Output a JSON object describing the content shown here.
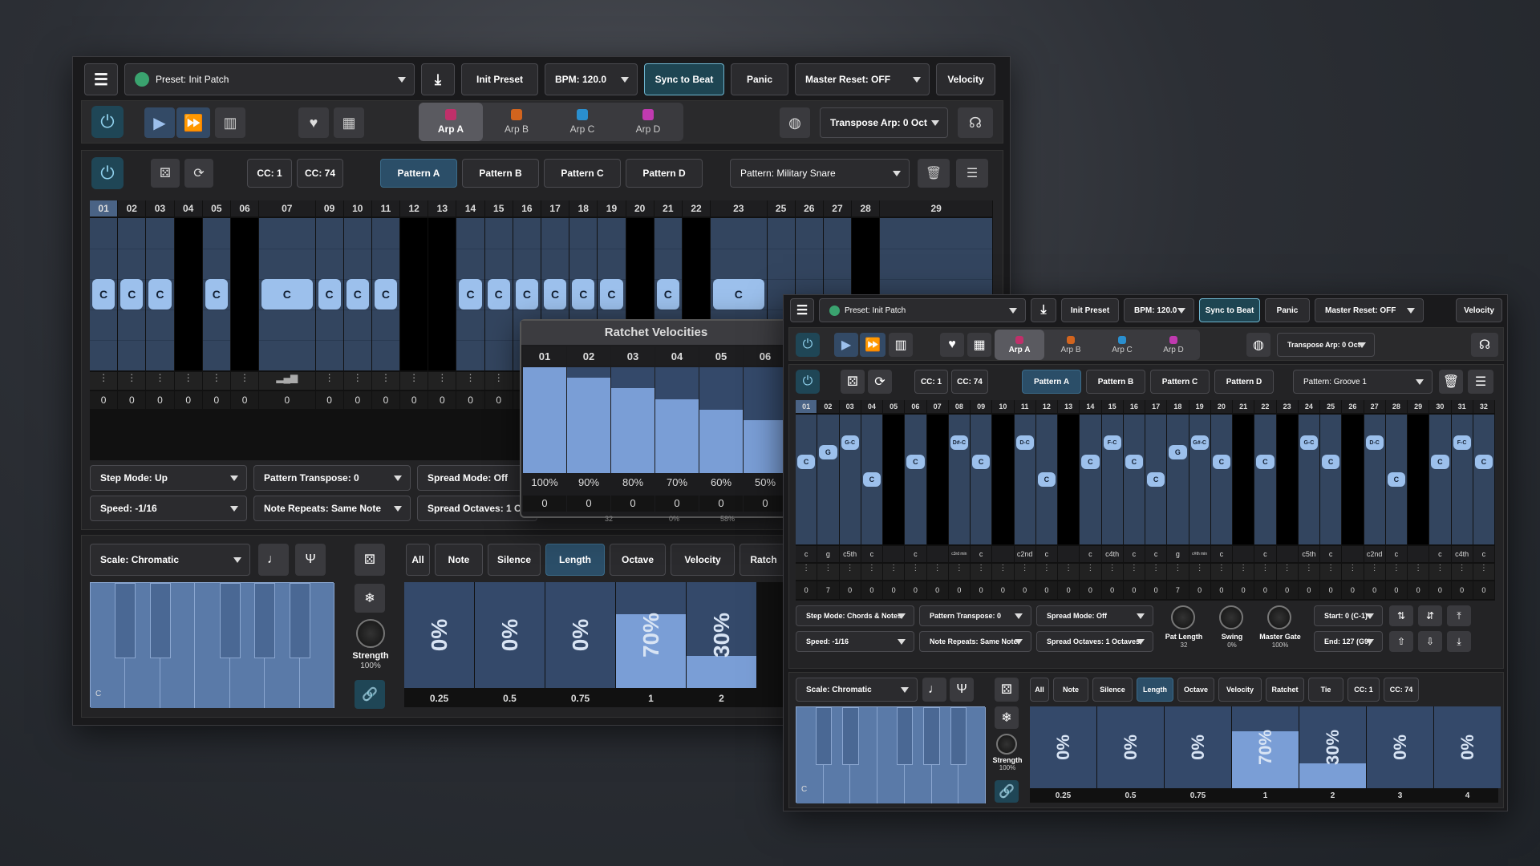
{
  "left": {
    "preset": "Preset: Init Patch",
    "init_preset": "Init Preset",
    "bpm": "BPM: 120.0",
    "sync": "Sync to Beat",
    "panic": "Panic",
    "master_reset": "Master Reset: OFF",
    "velocity": "Velocity",
    "arps": [
      "Arp A",
      "Arp B",
      "Arp C",
      "Arp D"
    ],
    "transpose_arp": "Transpose Arp: 0 Oct",
    "cc1": "CC: 1",
    "cc2": "CC: 74",
    "patterns": [
      "Pattern A",
      "Pattern B",
      "Pattern C",
      "Pattern D"
    ],
    "pattern_select": "Pattern: Military Snare",
    "steps": [
      "01",
      "02",
      "03",
      "04",
      "05",
      "06",
      "07",
      "09",
      "10",
      "11",
      "12",
      "13",
      "14",
      "15",
      "16",
      "17",
      "18",
      "19",
      "20",
      "21",
      "22",
      "23",
      "25",
      "26",
      "27",
      "28",
      "29"
    ],
    "notes": [
      "C",
      "C",
      "C",
      "",
      "C",
      "",
      "C",
      "C",
      "C",
      "C",
      "",
      "",
      "C",
      "C",
      "C",
      "C",
      "C",
      "C",
      "",
      "C",
      "",
      "C",
      "",
      "",
      "",
      "",
      ""
    ],
    "zeros": [
      "0",
      "0",
      "0",
      "0",
      "0",
      "0",
      "0",
      "0",
      "0",
      "0",
      "0",
      "0",
      "0",
      "0",
      "0",
      "0"
    ],
    "step_mode": "Step Mode: Up",
    "pattern_transpose": "Pattern Transpose: 0",
    "spread_mode": "Spread Mode: Off",
    "speed": "Speed: -1/16",
    "note_repeats": "Note Repeats: Same Note",
    "spread_octaves": "Spread Octaves: 1 Octa",
    "scale": "Scale: Chromatic",
    "strength": "Strength",
    "strength_val": "100%",
    "key_c": "C",
    "lanes": [
      "All",
      "Note",
      "Silence",
      "Length",
      "Octave",
      "Velocity",
      "Ratch"
    ],
    "length_bars": [
      {
        "v": "0%",
        "f": 0
      },
      {
        "v": "0%",
        "f": 0
      },
      {
        "v": "0%",
        "f": 0
      },
      {
        "v": "70%",
        "f": 0.7
      },
      {
        "v": "30%",
        "f": 0.3
      }
    ],
    "length_labels": [
      "0.25",
      "0.5",
      "0.75",
      "1",
      "2"
    ]
  },
  "ratchet": {
    "title": "Ratchet Velocities",
    "cols": [
      "01",
      "02",
      "03",
      "04",
      "05",
      "06"
    ],
    "values": [
      100,
      90,
      80,
      70,
      60,
      50
    ],
    "pct": [
      "100%",
      "90%",
      "80%",
      "70%",
      "60%",
      "50%"
    ],
    "zeros": [
      "0",
      "0",
      "0",
      "0",
      "0",
      "0"
    ],
    "sub": [
      "32",
      "0%",
      "58%"
    ]
  },
  "right": {
    "preset": "Preset: Init Patch",
    "init_preset": "Init Preset",
    "bpm": "BPM: 120.0",
    "sync": "Sync to Beat",
    "panic": "Panic",
    "master_reset": "Master Reset: OFF",
    "velocity": "Velocity",
    "arps": [
      "Arp A",
      "Arp B",
      "Arp C",
      "Arp D"
    ],
    "transpose_arp": "Transpose Arp: 0 Oct",
    "cc1": "CC: 1",
    "cc2": "CC: 74",
    "patterns": [
      "Pattern A",
      "Pattern B",
      "Pattern C",
      "Pattern D"
    ],
    "pattern_select": "Pattern: Groove 1",
    "steps": [
      "01",
      "02",
      "03",
      "04",
      "05",
      "06",
      "07",
      "08",
      "09",
      "10",
      "11",
      "12",
      "13",
      "14",
      "15",
      "16",
      "17",
      "18",
      "19",
      "20",
      "21",
      "22",
      "23",
      "24",
      "25",
      "26",
      "27",
      "28",
      "29",
      "30",
      "31",
      "32"
    ],
    "notes": [
      "C",
      "G",
      "G-C",
      "C",
      "",
      "C",
      "",
      "D#-C",
      "C",
      "",
      "D-C",
      "C",
      "",
      "C",
      "F-C",
      "C",
      "C",
      "G",
      "G#-C",
      "C",
      "",
      "C",
      "",
      "G-C",
      "C",
      "",
      "D-C",
      "C",
      "",
      "C",
      "F-C",
      "C"
    ],
    "note_lbl": [
      "c",
      "g",
      "c5th",
      "c",
      "",
      "c",
      "",
      "c3rd min",
      "c",
      "",
      "c2nd",
      "c",
      "",
      "c",
      "c4th",
      "c",
      "c",
      "g",
      "c#th min",
      "c",
      "",
      "c",
      "",
      "c5th",
      "c",
      "",
      "c2nd",
      "c",
      "",
      "c",
      "c4th",
      "c"
    ],
    "vel": [
      "0",
      "7",
      "0",
      "0",
      "0",
      "0",
      "0",
      "0",
      "0",
      "0",
      "0",
      "0",
      "0",
      "0",
      "0",
      "0",
      "0",
      "7",
      "0",
      "0",
      "0",
      "0",
      "0",
      "0",
      "0",
      "0",
      "0",
      "0",
      "0",
      "0",
      "0",
      "0"
    ],
    "step_mode": "Step Mode: Chords & Notes",
    "pattern_transpose": "Pattern Transpose: 0",
    "spread_mode": "Spread Mode: Off",
    "speed": "Speed: -1/16",
    "note_repeats": "Note Repeats: Same Note",
    "spread_octaves": "Spread Octaves: 1 Octaves",
    "knobs": [
      {
        "l": "Pat Length",
        "v": "32"
      },
      {
        "l": "Swing",
        "v": "0%"
      },
      {
        "l": "Master Gate",
        "v": "100%"
      }
    ],
    "start": "Start: 0 (C-1)",
    "end": "End: 127 (G9)",
    "scale": "Scale: Chromatic",
    "strength": "Strength",
    "strength_val": "100%",
    "key_c": "C",
    "lanes": [
      "All",
      "Note",
      "Silence",
      "Length",
      "Octave",
      "Velocity",
      "Ratchet",
      "Tie",
      "CC: 1",
      "CC: 74"
    ],
    "length_bars": [
      {
        "v": "0%",
        "f": 0
      },
      {
        "v": "0%",
        "f": 0
      },
      {
        "v": "0%",
        "f": 0
      },
      {
        "v": "70%",
        "f": 0.7
      },
      {
        "v": "30%",
        "f": 0.3
      },
      {
        "v": "0%",
        "f": 0
      },
      {
        "v": "0%",
        "f": 0
      }
    ],
    "length_labels": [
      "0.25",
      "0.5",
      "0.75",
      "1",
      "2",
      "3",
      "4"
    ]
  },
  "colors": {
    "arpA": "#c0306a",
    "arpB": "#d2641e",
    "arpC": "#2a8fcf",
    "arpD": "#c03ab0",
    "note": "#9cc0ec",
    "bar": "#7a9ed6"
  }
}
